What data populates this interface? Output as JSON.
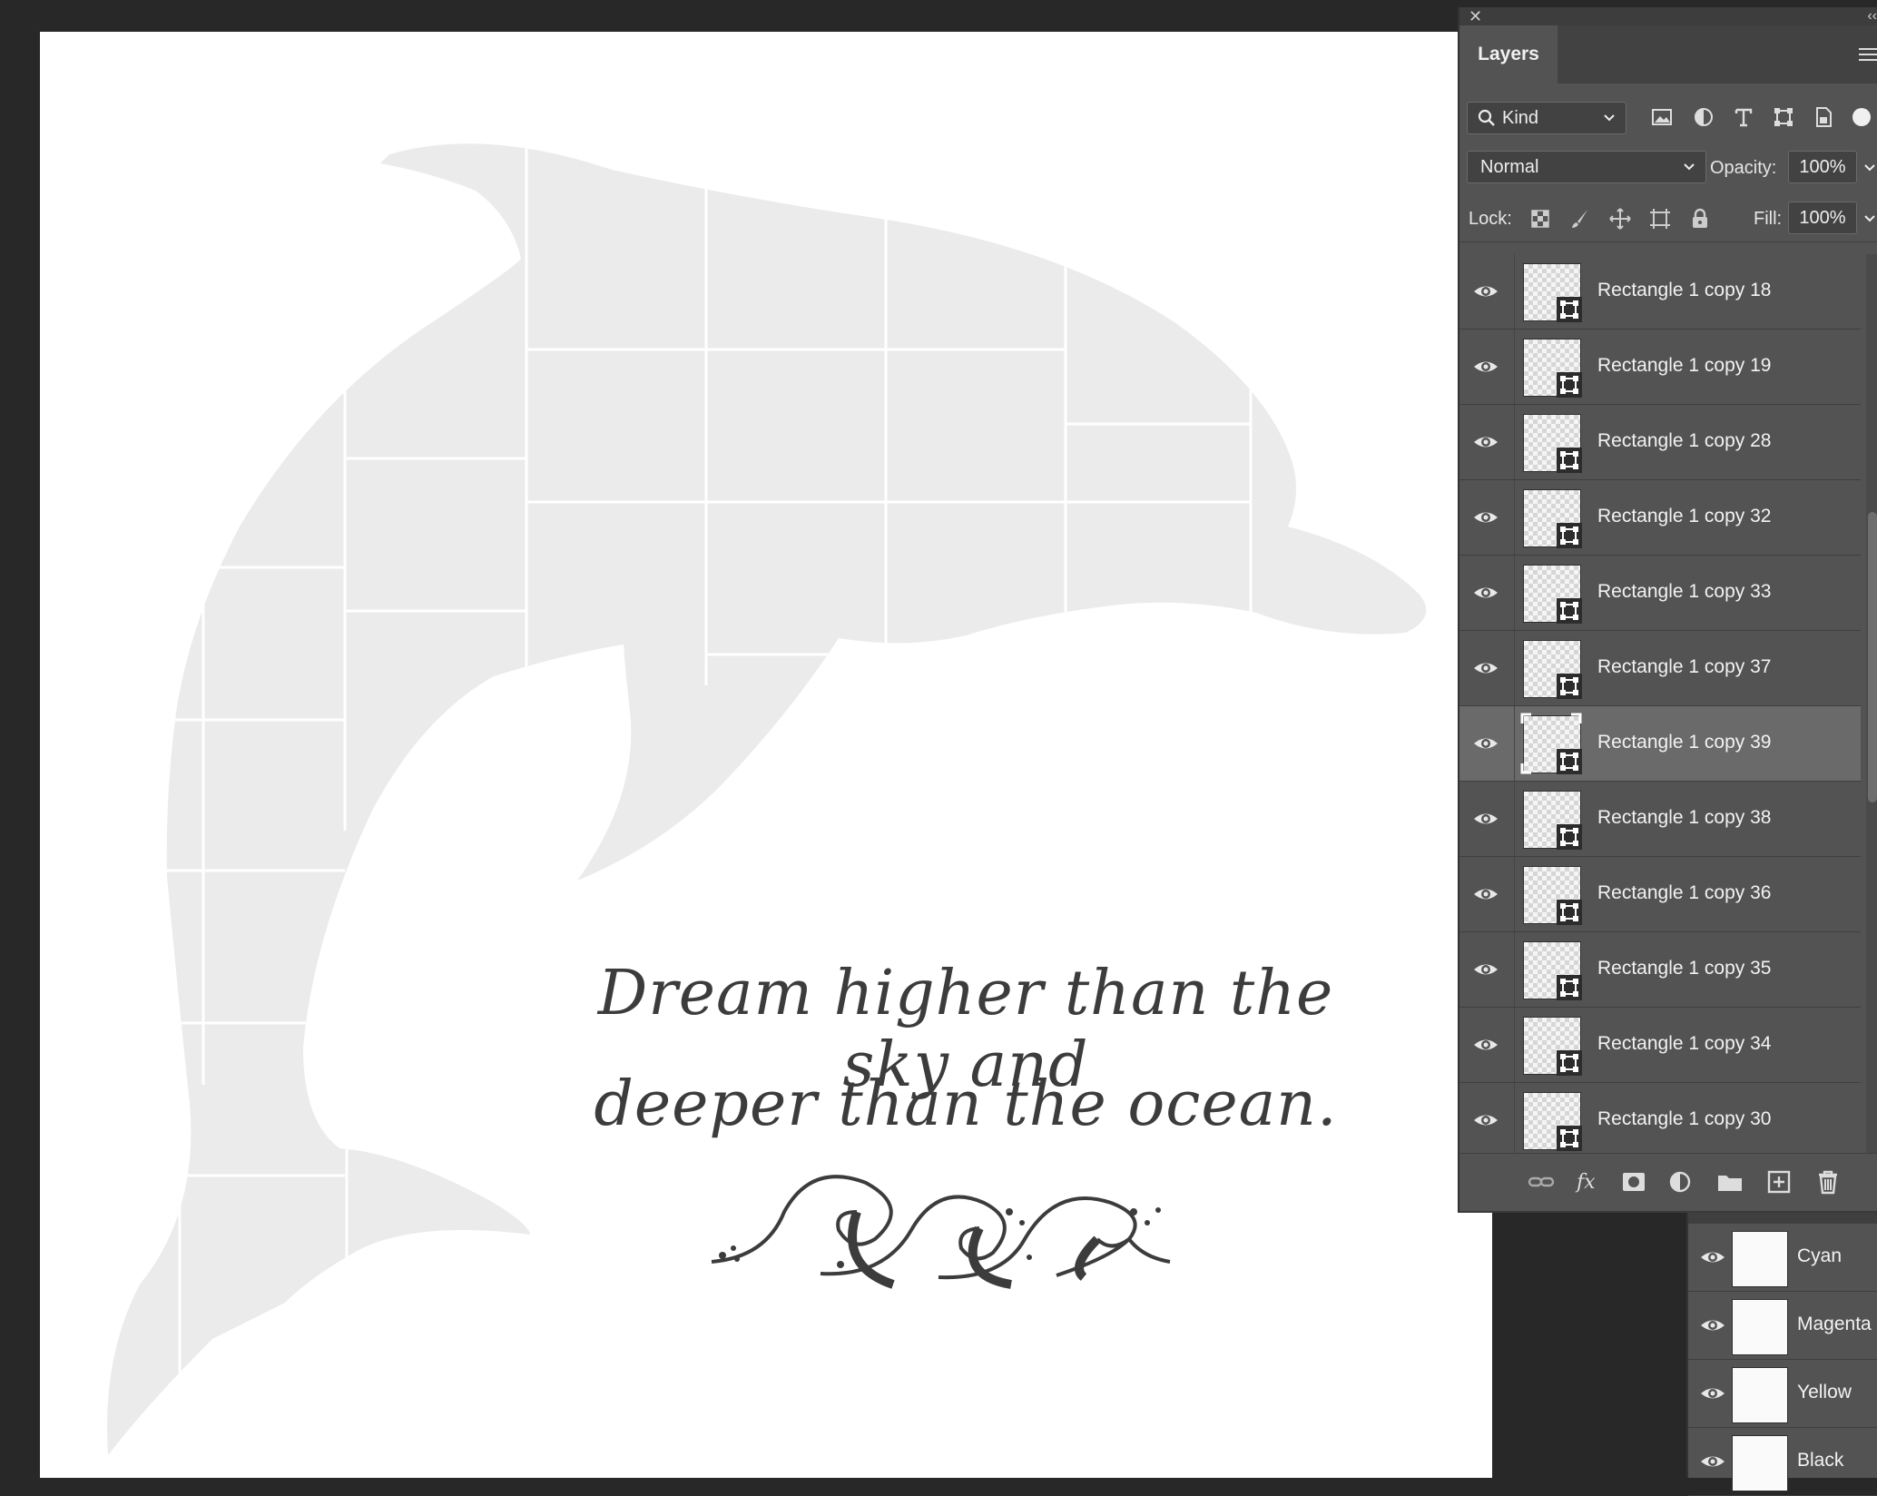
{
  "canvas": {
    "quote_line1": "Dream higher than the sky and",
    "quote_line2": "deeper than the ocean."
  },
  "layers_panel": {
    "title": "Layers",
    "filter_kind": "Kind",
    "blend_mode": "Normal",
    "opacity_label": "Opacity:",
    "opacity_value": "100%",
    "lock_label": "Lock:",
    "fill_label": "Fill:",
    "fill_value": "100%",
    "layers": [
      {
        "name": "Rectangle 1 copy 18",
        "visible": true,
        "selected": false
      },
      {
        "name": "Rectangle 1 copy 19",
        "visible": true,
        "selected": false
      },
      {
        "name": "Rectangle 1 copy 28",
        "visible": true,
        "selected": false
      },
      {
        "name": "Rectangle 1 copy 32",
        "visible": true,
        "selected": false
      },
      {
        "name": "Rectangle 1 copy 33",
        "visible": true,
        "selected": false
      },
      {
        "name": "Rectangle 1 copy 37",
        "visible": true,
        "selected": false
      },
      {
        "name": "Rectangle 1 copy 39",
        "visible": true,
        "selected": true
      },
      {
        "name": "Rectangle 1 copy 38",
        "visible": true,
        "selected": false
      },
      {
        "name": "Rectangle 1 copy 36",
        "visible": true,
        "selected": false
      },
      {
        "name": "Rectangle 1 copy 35",
        "visible": true,
        "selected": false
      },
      {
        "name": "Rectangle 1 copy 34",
        "visible": true,
        "selected": false
      },
      {
        "name": "Rectangle 1 copy 30",
        "visible": true,
        "selected": false
      }
    ]
  },
  "channels_panel": {
    "channels": [
      {
        "name": "Cyan",
        "visible": true
      },
      {
        "name": "Magenta",
        "visible": true
      },
      {
        "name": "Yellow",
        "visible": true
      },
      {
        "name": "Black",
        "visible": true
      }
    ]
  },
  "colors": {
    "app_background": "#282828",
    "panel_background": "#535353",
    "selected_row": "#6a6a6a",
    "dolphin_fill": "#ebebeb",
    "text_ink": "#3c3c3c"
  }
}
